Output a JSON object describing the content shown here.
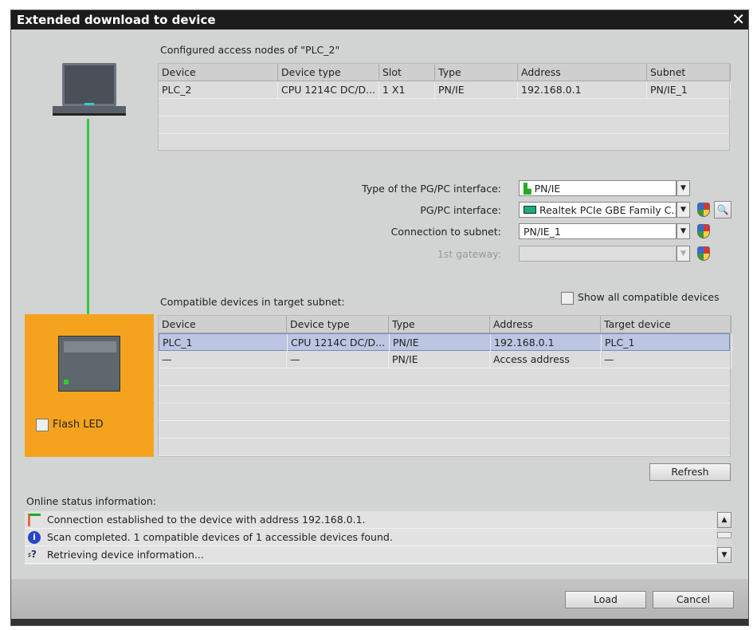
{
  "window": {
    "title": "Extended download to device",
    "close": "✕"
  },
  "configured": {
    "title": "Configured access nodes of \"PLC_2\"",
    "columns": [
      "Device",
      "Device type",
      "Slot",
      "Type",
      "Address",
      "Subnet"
    ],
    "rows": [
      [
        "PLC_2",
        "CPU 1214C DC/D...",
        "1 X1",
        "PN/IE",
        "192.168.0.1",
        "PN/IE_1"
      ]
    ]
  },
  "interface": {
    "type_label": "Type of the PG/PC interface:",
    "type_value": "PN/IE",
    "pgpc_label": "PG/PC interface:",
    "pgpc_value": "Realtek PCIe GBE Family C...",
    "subnet_label": "Connection to subnet:",
    "subnet_value": "PN/IE_1",
    "gateway_label": "1st gateway:",
    "gateway_value": ""
  },
  "compatible": {
    "title": "Compatible devices in target subnet:",
    "show_all": "Show all compatible devices",
    "columns": [
      "Device",
      "Device type",
      "Type",
      "Address",
      "Target device"
    ],
    "rows": [
      [
        "PLC_1",
        "CPU 1214C DC/D...",
        "PN/IE",
        "192.168.0.1",
        "PLC_1"
      ],
      [
        "—",
        "—",
        "PN/IE",
        "Access address",
        "—"
      ]
    ]
  },
  "flash_led": "Flash LED",
  "refresh": "Refresh",
  "status": {
    "title": "Online status information:",
    "messages": [
      "Connection established to the device with address 192.168.0.1.",
      "Scan completed. 1 compatible devices of 1 accessible devices found.",
      "Retrieving device information..."
    ]
  },
  "buttons": {
    "load": "Load",
    "cancel": "Cancel"
  },
  "colors": {
    "orange": "#f5a31f",
    "link": "#2ecc40",
    "selected": "#bcc6e2"
  }
}
